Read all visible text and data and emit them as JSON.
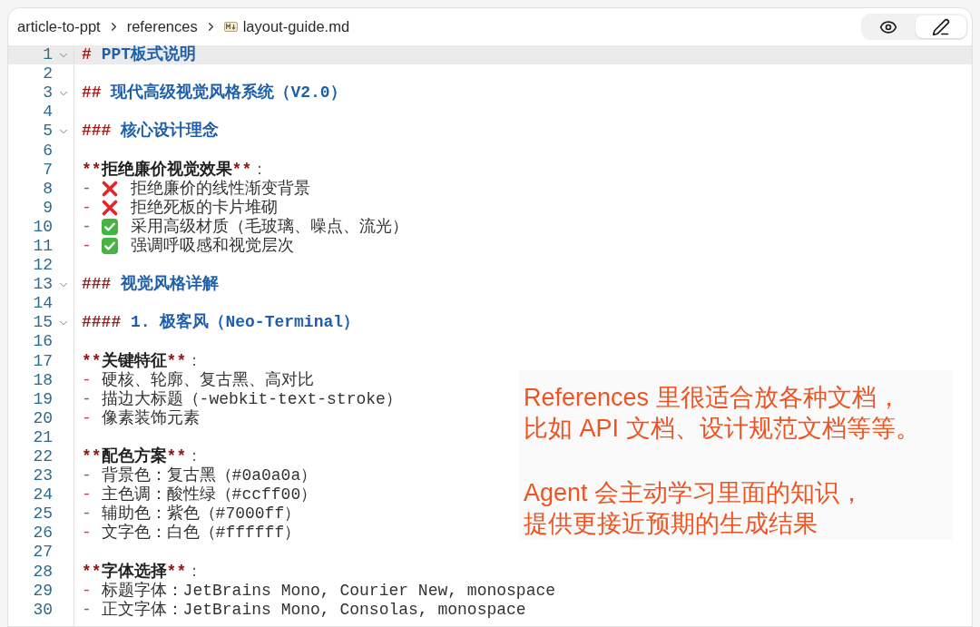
{
  "breadcrumb": [
    {
      "label": "article-to-ppt",
      "kind": "folder"
    },
    {
      "label": "references",
      "kind": "folder"
    },
    {
      "label": "layout-guide.md",
      "kind": "file"
    }
  ],
  "view_modes": [
    {
      "kind": "preview",
      "selected": false
    },
    {
      "kind": "edit",
      "selected": true
    }
  ],
  "editor": {
    "lines": [
      {
        "number": "1",
        "kind": "heading",
        "marker": "#",
        "text": "PPT板式说明",
        "expanded": true,
        "selected": true
      },
      {
        "number": "2",
        "kind": "blank",
        "selected": false
      },
      {
        "number": "3",
        "kind": "heading",
        "marker": "##",
        "text": "现代高级视觉风格系统（V2.0）",
        "expanded": true,
        "selected": false
      },
      {
        "number": "4",
        "kind": "blank",
        "selected": false
      },
      {
        "number": "5",
        "kind": "heading",
        "marker": "###",
        "text": "核心设计理念",
        "expanded": true,
        "selected": false
      },
      {
        "number": "6",
        "kind": "blank",
        "selected": false
      },
      {
        "number": "7",
        "kind": "bold",
        "open": "**",
        "text": "拒绝廉价视觉效果",
        "close": "**",
        "suffix": "：",
        "selected": false
      },
      {
        "number": "8",
        "kind": "list",
        "bullet": "-",
        "approved": false,
        "text": "拒绝廉价的线性渐变背景",
        "selected": false
      },
      {
        "number": "9",
        "kind": "list",
        "bullet": "-",
        "approved": false,
        "text": "拒绝死板的卡片堆砌",
        "selected": false
      },
      {
        "number": "10",
        "kind": "list",
        "bullet": "-",
        "approved": true,
        "text": "采用高级材质（毛玻璃、噪点、流光）",
        "selected": false
      },
      {
        "number": "11",
        "kind": "list",
        "bullet": "-",
        "approved": true,
        "text": "强调呼吸感和视觉层次",
        "selected": false
      },
      {
        "number": "12",
        "kind": "blank",
        "selected": false
      },
      {
        "number": "13",
        "kind": "heading",
        "marker": "###",
        "text": "视觉风格详解",
        "expanded": true,
        "selected": false
      },
      {
        "number": "14",
        "kind": "blank",
        "selected": false
      },
      {
        "number": "15",
        "kind": "heading",
        "marker": "####",
        "text": "1. 极客风（Neo-Terminal）",
        "expanded": true,
        "selected": false
      },
      {
        "number": "16",
        "kind": "blank",
        "selected": false
      },
      {
        "number": "17",
        "kind": "bold",
        "open": "**",
        "text": "关键特征",
        "close": "**",
        "suffix": "：",
        "selected": false
      },
      {
        "number": "18",
        "kind": "list",
        "bullet": "-",
        "text": "硬核、轮廓、复古黑、高对比",
        "selected": false
      },
      {
        "number": "19",
        "kind": "list",
        "bullet": "-",
        "text": "描边大标题（-webkit-text-stroke）",
        "selected": false
      },
      {
        "number": "20",
        "kind": "list",
        "bullet": "-",
        "text": "像素装饰元素",
        "selected": false
      },
      {
        "number": "21",
        "kind": "blank",
        "selected": false
      },
      {
        "number": "22",
        "kind": "bold",
        "open": "**",
        "text": "配色方案",
        "close": "**",
        "suffix": "：",
        "selected": false
      },
      {
        "number": "23",
        "kind": "list",
        "bullet": "-",
        "text": "背景色：复古黑（#0a0a0a）",
        "selected": false
      },
      {
        "number": "24",
        "kind": "list",
        "bullet": "-",
        "text": "主色调：酸性绿（#ccff00）",
        "selected": false
      },
      {
        "number": "25",
        "kind": "list",
        "bullet": "-",
        "text": "辅助色：紫色（#7000ff）",
        "selected": false
      },
      {
        "number": "26",
        "kind": "list",
        "bullet": "-",
        "text": "文字色：白色（#ffffff）",
        "selected": false
      },
      {
        "number": "27",
        "kind": "blank",
        "selected": false
      },
      {
        "number": "28",
        "kind": "bold",
        "open": "**",
        "text": "字体选择",
        "close": "**",
        "suffix": "：",
        "selected": false
      },
      {
        "number": "29",
        "kind": "list",
        "bullet": "-",
        "text": "标题字体：JetBrains Mono, Courier New, monospace",
        "selected": false
      },
      {
        "number": "30",
        "kind": "list",
        "bullet": "-",
        "text": "正文字体：JetBrains Mono, Consolas, monospace",
        "selected": false
      }
    ]
  },
  "annotation": {
    "paragraphs": [
      {
        "lines": [
          "References 里很适合放各种文档，",
          "比如 API 文档、设计规范文档等等。"
        ]
      },
      {
        "lines": [
          "Agent 会主动学习里面的知识，",
          "提供更接近预期的生成结果"
        ]
      }
    ]
  }
}
